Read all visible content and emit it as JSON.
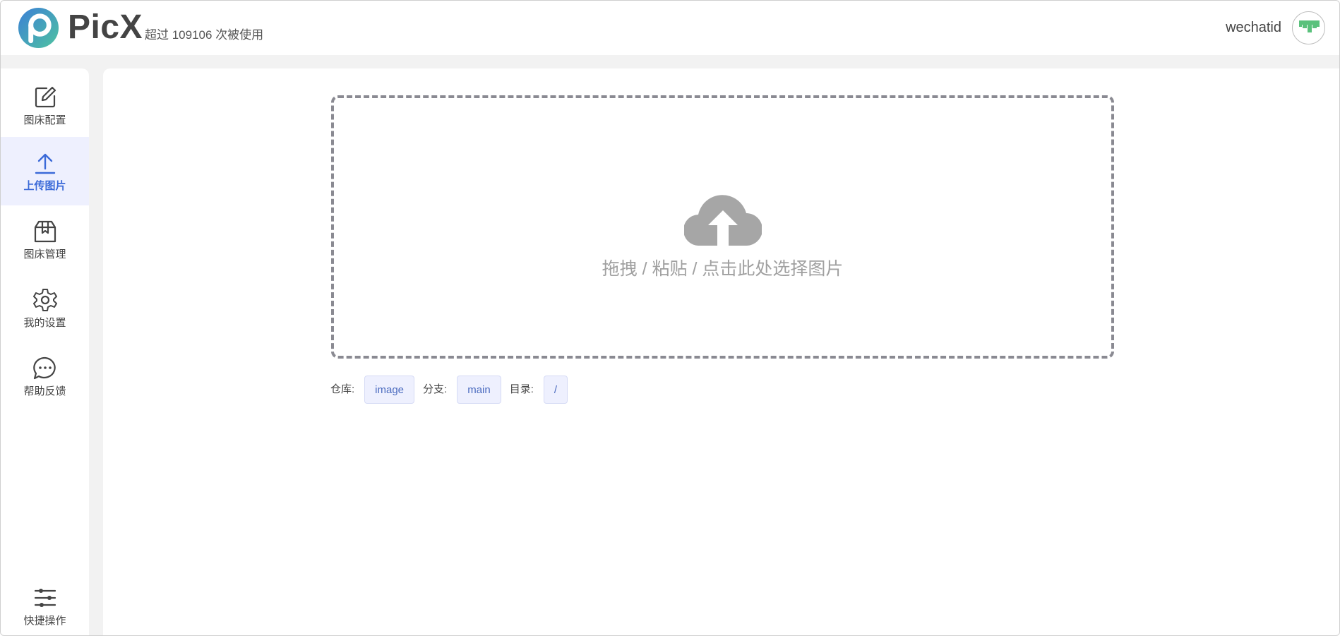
{
  "header": {
    "brand": "PicX",
    "usage": "超过 109106 次被使用",
    "username": "wechatid"
  },
  "sidebar": {
    "items": [
      {
        "label": "图床配置",
        "icon": "edit-icon"
      },
      {
        "label": "上传图片",
        "icon": "upload-icon",
        "active": true
      },
      {
        "label": "图床管理",
        "icon": "box-icon"
      },
      {
        "label": "我的设置",
        "icon": "gear-icon"
      },
      {
        "label": "帮助反馈",
        "icon": "chat-icon"
      }
    ],
    "bottom": {
      "label": "快捷操作",
      "icon": "sliders-icon"
    }
  },
  "upload": {
    "hint": "拖拽 / 粘贴 / 点击此处选择图片"
  },
  "meta": {
    "repo_label": "仓库:",
    "repo_value": "image",
    "branch_label": "分支:",
    "branch_value": "main",
    "dir_label": "目录:",
    "dir_value": "/"
  },
  "colors": {
    "accent": "#3b6ad8",
    "active_bg": "#eef0fe",
    "dashed_border": "#8a8a92",
    "cloud": "#a6a6a6"
  }
}
